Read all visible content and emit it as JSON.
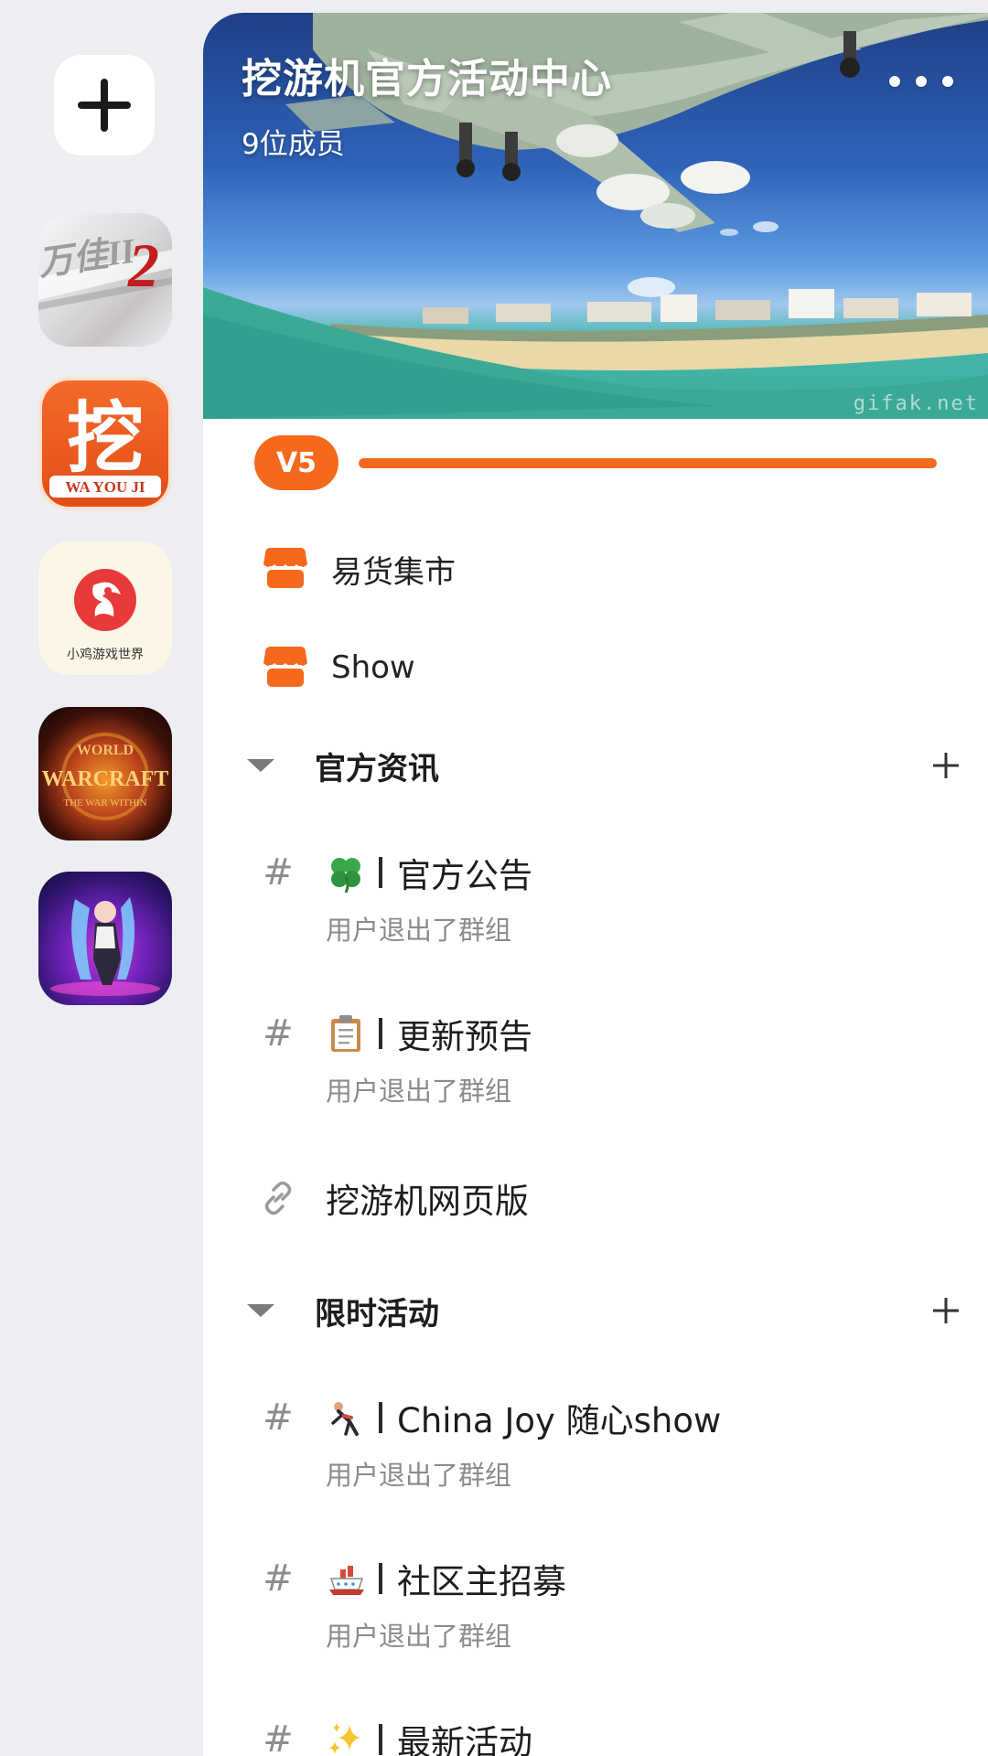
{
  "rail": {
    "add_icon": "plus-icon",
    "servers": [
      {
        "name": "server-1",
        "badge_text": "2"
      },
      {
        "name": "server-2",
        "badge_text": "挖",
        "badge_sub": "WA YOU JI"
      },
      {
        "name": "server-3",
        "badge_sub": "小鸡游戏世界"
      },
      {
        "name": "server-4",
        "badge_text": "WARCRAFT"
      },
      {
        "name": "server-5"
      }
    ]
  },
  "header": {
    "title": "挖游机官方活动中心",
    "members": "9位成员",
    "more_icon": "more-horizontal-icon",
    "watermark": "gifak.net"
  },
  "level": {
    "badge": "V5",
    "progress": 1.0,
    "color": "#f5691c"
  },
  "shops": [
    {
      "icon": "shop-icon",
      "label": "易货集市"
    },
    {
      "icon": "shop-icon",
      "label": "Show"
    }
  ],
  "categories": [
    {
      "label": "官方资讯",
      "channels": [
        {
          "emoji": "clover-icon",
          "name": "官方公告",
          "sub": "用户退出了群组"
        },
        {
          "emoji": "clipboard-icon",
          "name": "更新预告",
          "sub": "用户退出了群组"
        },
        {
          "type": "link",
          "name": "挖游机网页版"
        }
      ]
    },
    {
      "label": "限时活动",
      "channels": [
        {
          "emoji": "gymnast-icon",
          "name": "China Joy 随心show",
          "sub": "用户退出了群组"
        },
        {
          "emoji": "ship-icon",
          "name": "社区主招募",
          "sub": "用户退出了群组"
        },
        {
          "emoji": "sparkles-icon",
          "name": "最新活动"
        }
      ]
    }
  ],
  "symbols": {
    "hash": "#"
  },
  "colors": {
    "accent": "#f5691c",
    "rail_bg": "#eceef1",
    "muted": "#8b8b8b"
  }
}
